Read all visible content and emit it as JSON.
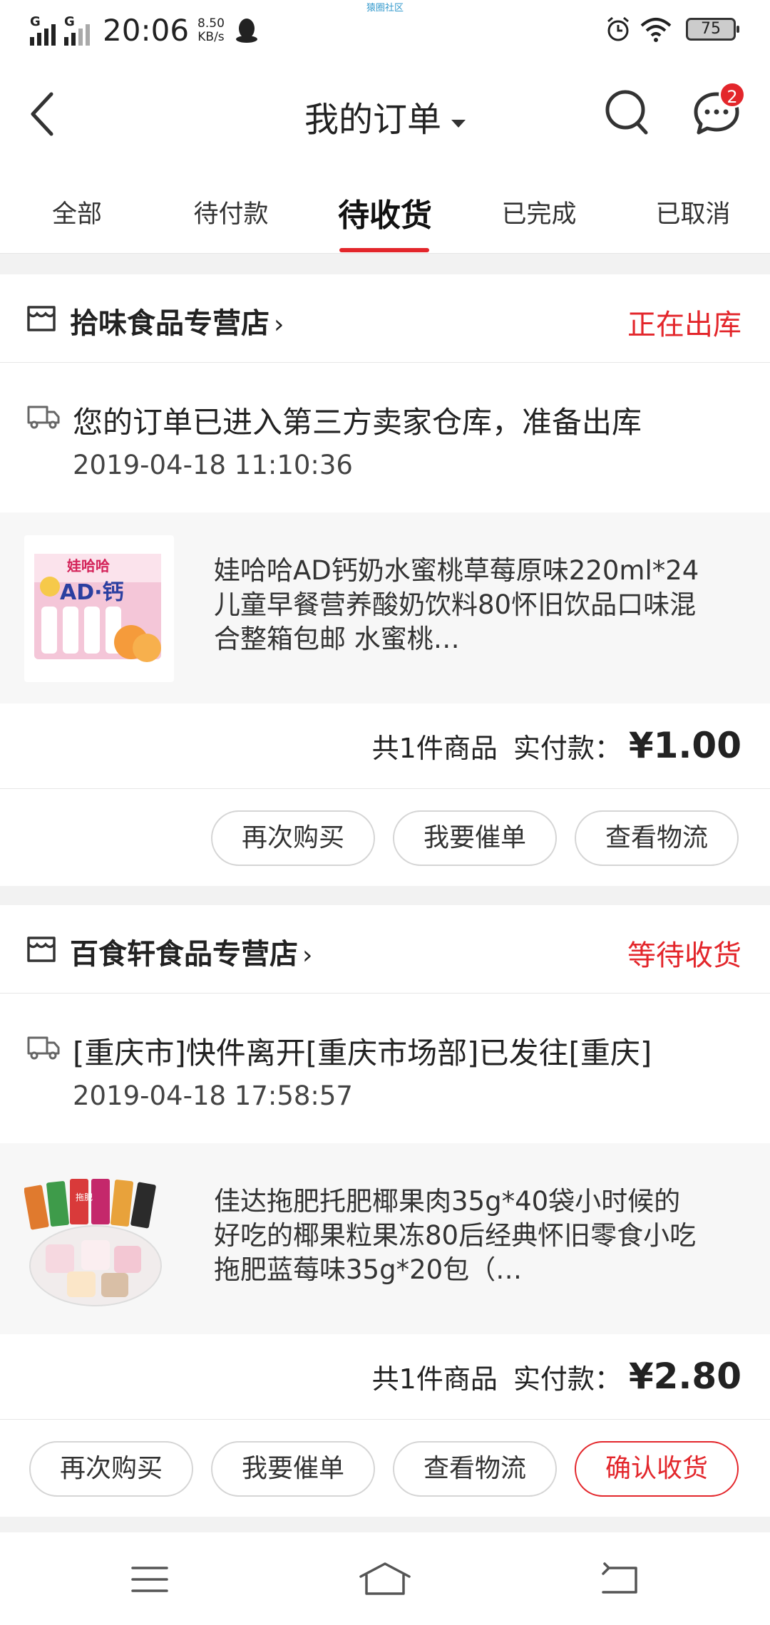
{
  "status_bar": {
    "signal1": "G",
    "signal2": "G",
    "time": "20:06",
    "speed_value": "8.50",
    "speed_unit": "KB/s",
    "center_text": "猿圈社区",
    "battery": "75"
  },
  "header": {
    "title": "我的订单",
    "message_badge": "2"
  },
  "tabs": [
    {
      "label": "全部"
    },
    {
      "label": "待付款"
    },
    {
      "label": "待收货"
    },
    {
      "label": "已完成"
    },
    {
      "label": "已取消"
    }
  ],
  "active_tab_index": 2,
  "orders": [
    {
      "shop_name": "拾味食品专营店",
      "status": "正在出库",
      "logistics_text": "您的订单已进入第三方卖家仓库，准备出库",
      "logistics_time": "2019-04-18 11:10:36",
      "product_name": "娃哈哈AD钙奶水蜜桃草莓原味220ml*24儿童早餐营养酸奶饮料80怀旧饮品口味混合整箱包邮 水蜜桃…",
      "count_text": "共1件商品",
      "paid_label": "实付款：",
      "amount": "¥1.00",
      "buttons": [
        "再次购买",
        "我要催单",
        "查看物流"
      ]
    },
    {
      "shop_name": "百食轩食品专营店",
      "status": "等待收货",
      "logistics_text": "[重庆市]快件离开[重庆市场部]已发往[重庆]",
      "logistics_time": "2019-04-18 17:58:57",
      "product_name": "佳达拖肥托肥椰果肉35g*40袋小时候的好吃的椰果粒果冻80后经典怀旧零食小吃 拖肥蓝莓味35g*20包（…",
      "count_text": "共1件商品",
      "paid_label": "实付款：",
      "amount": "¥2.80",
      "buttons": [
        "再次购买",
        "我要催单",
        "查看物流",
        "确认收货"
      ]
    }
  ],
  "product_images": {
    "order0_brand": "娃哈哈",
    "order0_label": "AD·钙",
    "order1_label": "拖肥"
  },
  "colors": {
    "accent": "#e3262b",
    "background": "#f2f2f2"
  }
}
